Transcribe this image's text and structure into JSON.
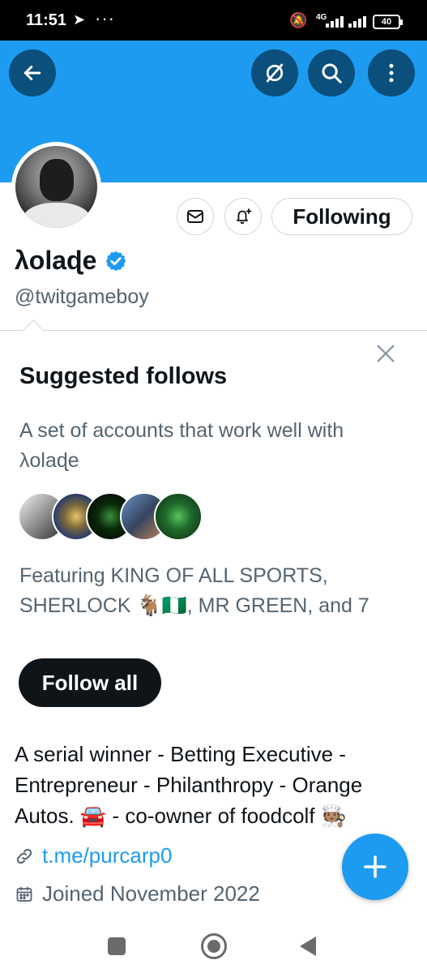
{
  "status_bar": {
    "time": "11:51",
    "network": "4G",
    "battery": "40"
  },
  "profile": {
    "name": "λolaɖe",
    "handle": "@twitgameboy",
    "following_label": "Following",
    "bio": "A serial winner  - Betting Executive - Entrepreneur - Philanthropy - Orange Autos. 🚘  - co-owner of foodcolf 🧑🏽‍🍳",
    "link": "t.me/purcarp0",
    "joined": "Joined November 2022"
  },
  "suggested": {
    "title": "Suggested follows",
    "description": "A set of accounts that work well with λolaɖe",
    "featuring": "Featuring KING OF ALL SPORTS, SHERLOCK 🐐🇳🇬, MR GREEN, and 7",
    "follow_all_label": "Follow all"
  },
  "colors": {
    "accent": "#1d9bf0",
    "banner": "#1d9bf0",
    "dark_button": "#0f1419",
    "muted_text": "#536471"
  },
  "icons": {
    "back": "arrow-left-icon",
    "mute": "slash-circle-icon",
    "search": "search-icon",
    "more": "more-vertical-icon",
    "message": "mail-icon",
    "notify": "bell-plus-icon",
    "verified": "verified-badge-icon",
    "close": "close-icon",
    "link": "link-icon",
    "calendar": "calendar-icon",
    "compose": "plus-icon"
  }
}
